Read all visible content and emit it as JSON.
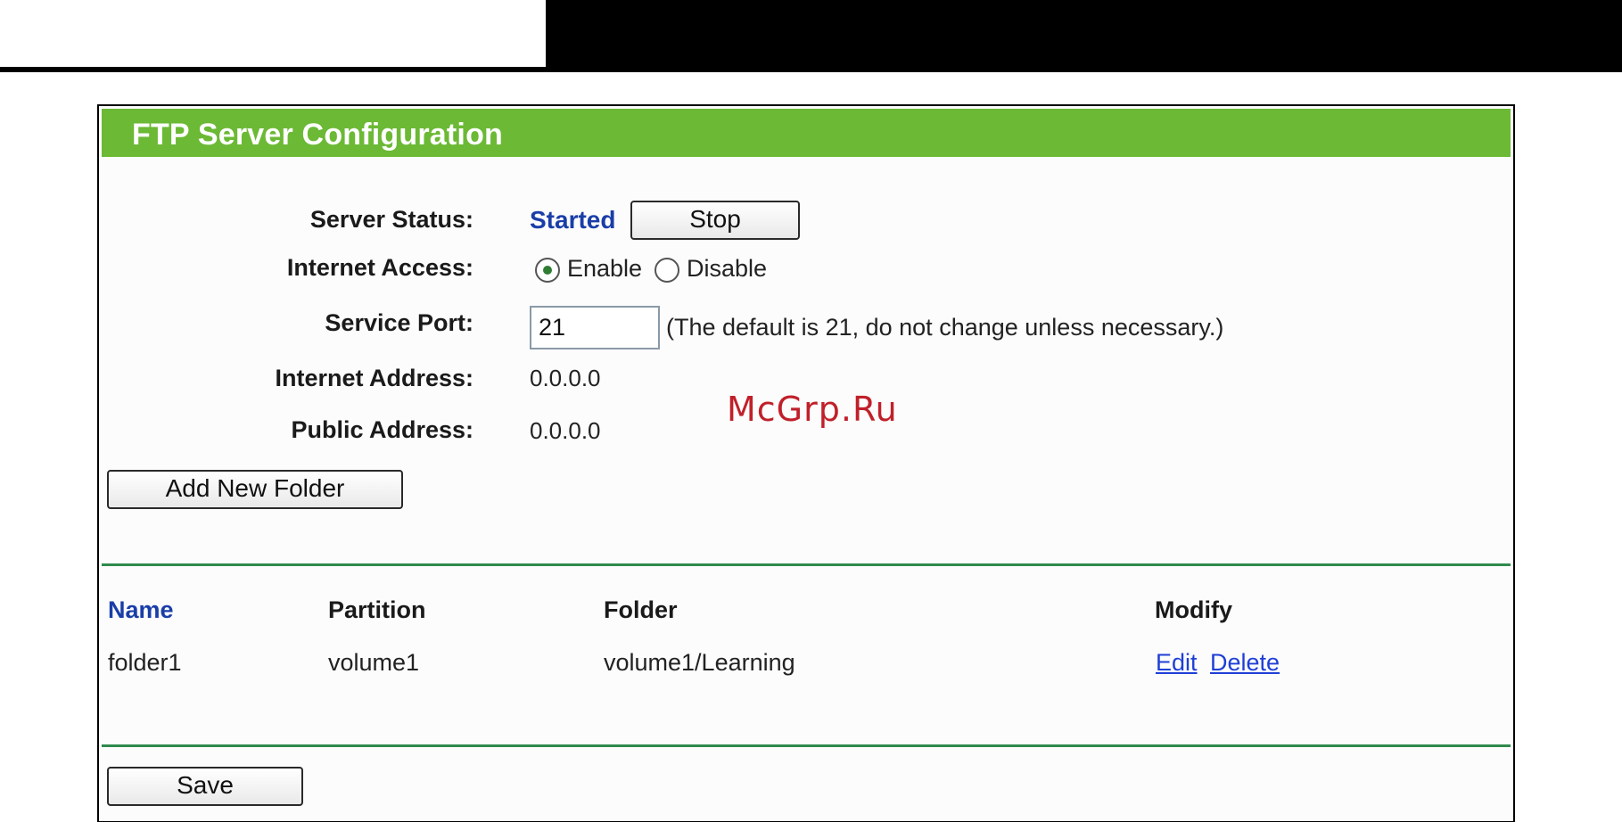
{
  "panel": {
    "title": "FTP Server Configuration",
    "header_color": "#6bb935"
  },
  "fields": {
    "server_status_label": "Server Status:",
    "server_status_value": "Started",
    "stop_button": "Stop",
    "internet_access_label": "Internet Access:",
    "enable_label": "Enable",
    "disable_label": "Disable",
    "internet_access_selected": "Enable",
    "service_port_label": "Service Port:",
    "service_port_value": "21",
    "service_port_hint": "(The default is 21, do not change unless necessary.)",
    "internet_address_label": "Internet Address:",
    "internet_address_value": "0.0.0.0",
    "public_address_label": "Public Address:",
    "public_address_value": "0.0.0.0"
  },
  "buttons": {
    "add_folder": "Add New Folder",
    "save": "Save"
  },
  "table": {
    "headers": {
      "name": "Name",
      "partition": "Partition",
      "folder": "Folder",
      "modify": "Modify"
    },
    "rows": [
      {
        "name": "folder1",
        "partition": "volume1",
        "folder": "volume1/Learning",
        "edit": "Edit",
        "delete": "Delete"
      }
    ]
  },
  "watermark": "McGrp.Ru",
  "colors": {
    "status": "#1a3ea8",
    "link": "#1f3fd6",
    "rule": "#2f8a4c"
  }
}
